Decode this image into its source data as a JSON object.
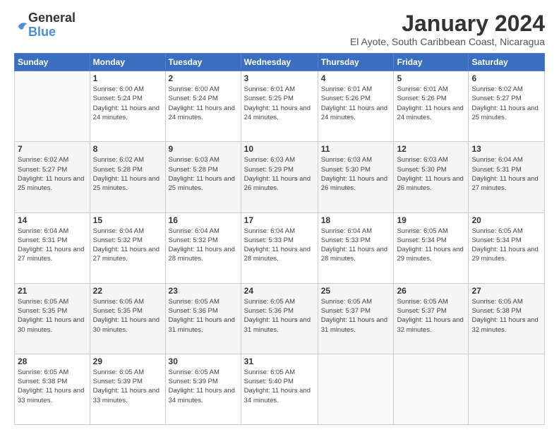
{
  "header": {
    "logo_general": "General",
    "logo_blue": "Blue",
    "month_title": "January 2024",
    "location": "El Ayote, South Caribbean Coast, Nicaragua"
  },
  "weekdays": [
    "Sunday",
    "Monday",
    "Tuesday",
    "Wednesday",
    "Thursday",
    "Friday",
    "Saturday"
  ],
  "weeks": [
    [
      {
        "day": "",
        "sunrise": "",
        "sunset": "",
        "daylight": ""
      },
      {
        "day": "1",
        "sunrise": "Sunrise: 6:00 AM",
        "sunset": "Sunset: 5:24 PM",
        "daylight": "Daylight: 11 hours and 24 minutes."
      },
      {
        "day": "2",
        "sunrise": "Sunrise: 6:00 AM",
        "sunset": "Sunset: 5:24 PM",
        "daylight": "Daylight: 11 hours and 24 minutes."
      },
      {
        "day": "3",
        "sunrise": "Sunrise: 6:01 AM",
        "sunset": "Sunset: 5:25 PM",
        "daylight": "Daylight: 11 hours and 24 minutes."
      },
      {
        "day": "4",
        "sunrise": "Sunrise: 6:01 AM",
        "sunset": "Sunset: 5:26 PM",
        "daylight": "Daylight: 11 hours and 24 minutes."
      },
      {
        "day": "5",
        "sunrise": "Sunrise: 6:01 AM",
        "sunset": "Sunset: 5:26 PM",
        "daylight": "Daylight: 11 hours and 24 minutes."
      },
      {
        "day": "6",
        "sunrise": "Sunrise: 6:02 AM",
        "sunset": "Sunset: 5:27 PM",
        "daylight": "Daylight: 11 hours and 25 minutes."
      }
    ],
    [
      {
        "day": "7",
        "sunrise": "Sunrise: 6:02 AM",
        "sunset": "Sunset: 5:27 PM",
        "daylight": "Daylight: 11 hours and 25 minutes."
      },
      {
        "day": "8",
        "sunrise": "Sunrise: 6:02 AM",
        "sunset": "Sunset: 5:28 PM",
        "daylight": "Daylight: 11 hours and 25 minutes."
      },
      {
        "day": "9",
        "sunrise": "Sunrise: 6:03 AM",
        "sunset": "Sunset: 5:28 PM",
        "daylight": "Daylight: 11 hours and 25 minutes."
      },
      {
        "day": "10",
        "sunrise": "Sunrise: 6:03 AM",
        "sunset": "Sunset: 5:29 PM",
        "daylight": "Daylight: 11 hours and 26 minutes."
      },
      {
        "day": "11",
        "sunrise": "Sunrise: 6:03 AM",
        "sunset": "Sunset: 5:30 PM",
        "daylight": "Daylight: 11 hours and 26 minutes."
      },
      {
        "day": "12",
        "sunrise": "Sunrise: 6:03 AM",
        "sunset": "Sunset: 5:30 PM",
        "daylight": "Daylight: 11 hours and 26 minutes."
      },
      {
        "day": "13",
        "sunrise": "Sunrise: 6:04 AM",
        "sunset": "Sunset: 5:31 PM",
        "daylight": "Daylight: 11 hours and 27 minutes."
      }
    ],
    [
      {
        "day": "14",
        "sunrise": "Sunrise: 6:04 AM",
        "sunset": "Sunset: 5:31 PM",
        "daylight": "Daylight: 11 hours and 27 minutes."
      },
      {
        "day": "15",
        "sunrise": "Sunrise: 6:04 AM",
        "sunset": "Sunset: 5:32 PM",
        "daylight": "Daylight: 11 hours and 27 minutes."
      },
      {
        "day": "16",
        "sunrise": "Sunrise: 6:04 AM",
        "sunset": "Sunset: 5:32 PM",
        "daylight": "Daylight: 11 hours and 28 minutes."
      },
      {
        "day": "17",
        "sunrise": "Sunrise: 6:04 AM",
        "sunset": "Sunset: 5:33 PM",
        "daylight": "Daylight: 11 hours and 28 minutes."
      },
      {
        "day": "18",
        "sunrise": "Sunrise: 6:04 AM",
        "sunset": "Sunset: 5:33 PM",
        "daylight": "Daylight: 11 hours and 28 minutes."
      },
      {
        "day": "19",
        "sunrise": "Sunrise: 6:05 AM",
        "sunset": "Sunset: 5:34 PM",
        "daylight": "Daylight: 11 hours and 29 minutes."
      },
      {
        "day": "20",
        "sunrise": "Sunrise: 6:05 AM",
        "sunset": "Sunset: 5:34 PM",
        "daylight": "Daylight: 11 hours and 29 minutes."
      }
    ],
    [
      {
        "day": "21",
        "sunrise": "Sunrise: 6:05 AM",
        "sunset": "Sunset: 5:35 PM",
        "daylight": "Daylight: 11 hours and 30 minutes."
      },
      {
        "day": "22",
        "sunrise": "Sunrise: 6:05 AM",
        "sunset": "Sunset: 5:35 PM",
        "daylight": "Daylight: 11 hours and 30 minutes."
      },
      {
        "day": "23",
        "sunrise": "Sunrise: 6:05 AM",
        "sunset": "Sunset: 5:36 PM",
        "daylight": "Daylight: 11 hours and 31 minutes."
      },
      {
        "day": "24",
        "sunrise": "Sunrise: 6:05 AM",
        "sunset": "Sunset: 5:36 PM",
        "daylight": "Daylight: 11 hours and 31 minutes."
      },
      {
        "day": "25",
        "sunrise": "Sunrise: 6:05 AM",
        "sunset": "Sunset: 5:37 PM",
        "daylight": "Daylight: 11 hours and 31 minutes."
      },
      {
        "day": "26",
        "sunrise": "Sunrise: 6:05 AM",
        "sunset": "Sunset: 5:37 PM",
        "daylight": "Daylight: 11 hours and 32 minutes."
      },
      {
        "day": "27",
        "sunrise": "Sunrise: 6:05 AM",
        "sunset": "Sunset: 5:38 PM",
        "daylight": "Daylight: 11 hours and 32 minutes."
      }
    ],
    [
      {
        "day": "28",
        "sunrise": "Sunrise: 6:05 AM",
        "sunset": "Sunset: 5:38 PM",
        "daylight": "Daylight: 11 hours and 33 minutes."
      },
      {
        "day": "29",
        "sunrise": "Sunrise: 6:05 AM",
        "sunset": "Sunset: 5:39 PM",
        "daylight": "Daylight: 11 hours and 33 minutes."
      },
      {
        "day": "30",
        "sunrise": "Sunrise: 6:05 AM",
        "sunset": "Sunset: 5:39 PM",
        "daylight": "Daylight: 11 hours and 34 minutes."
      },
      {
        "day": "31",
        "sunrise": "Sunrise: 6:05 AM",
        "sunset": "Sunset: 5:40 PM",
        "daylight": "Daylight: 11 hours and 34 minutes."
      },
      {
        "day": "",
        "sunrise": "",
        "sunset": "",
        "daylight": ""
      },
      {
        "day": "",
        "sunrise": "",
        "sunset": "",
        "daylight": ""
      },
      {
        "day": "",
        "sunrise": "",
        "sunset": "",
        "daylight": ""
      }
    ]
  ]
}
